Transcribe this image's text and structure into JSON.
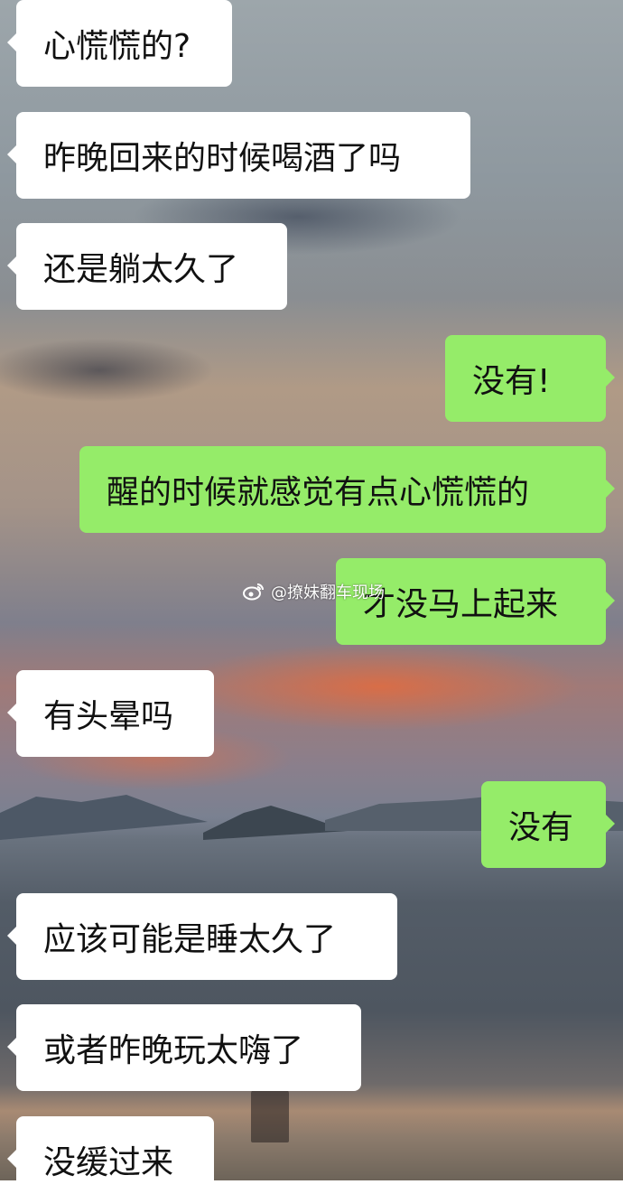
{
  "messages": [
    {
      "side": "in",
      "text": "心慌慌的?"
    },
    {
      "side": "in",
      "text": "昨晚回来的时候喝酒了吗"
    },
    {
      "side": "in",
      "text": "还是躺太久了"
    },
    {
      "side": "out",
      "text": "没有!"
    },
    {
      "side": "out",
      "text": "醒的时候就感觉有点心慌慌的"
    },
    {
      "side": "out",
      "text": "才没马上起来"
    },
    {
      "side": "in",
      "text": "有头晕吗"
    },
    {
      "side": "out",
      "text": "没有"
    },
    {
      "side": "in",
      "text": "应该可能是睡太久了"
    },
    {
      "side": "in",
      "text": "或者昨晚玩太嗨了"
    },
    {
      "side": "in",
      "text": "没缓过来"
    }
  ],
  "watermark": {
    "icon": "weibo-icon",
    "text": "@撩妹翻车现场"
  },
  "colors": {
    "incoming_bubble": "#ffffff",
    "outgoing_bubble": "#95ec69"
  }
}
